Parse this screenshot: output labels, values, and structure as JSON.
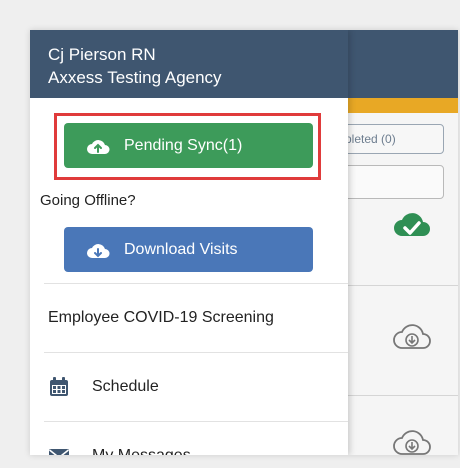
{
  "drawer": {
    "user_name": "Cj Pierson RN",
    "agency_name": "Axxess Testing Agency",
    "pending_sync_label": "Pending Sync(1)",
    "offline_prompt": "Going Offline?",
    "download_visits_label": "Download Visits",
    "menu": [
      {
        "label": "Employee COVID-19 Screening",
        "icon": null
      },
      {
        "label": "Schedule",
        "icon": "calendar-icon"
      },
      {
        "label": "My Messages",
        "icon": "envelope-icon"
      }
    ]
  },
  "background": {
    "completed_tab_label": "pleted (0)"
  },
  "colors": {
    "header": "#3f5670",
    "accent": "#e8a825",
    "sync_button": "#3d9b5a",
    "download_button": "#4a77b8",
    "highlight": "#e03b3b"
  }
}
